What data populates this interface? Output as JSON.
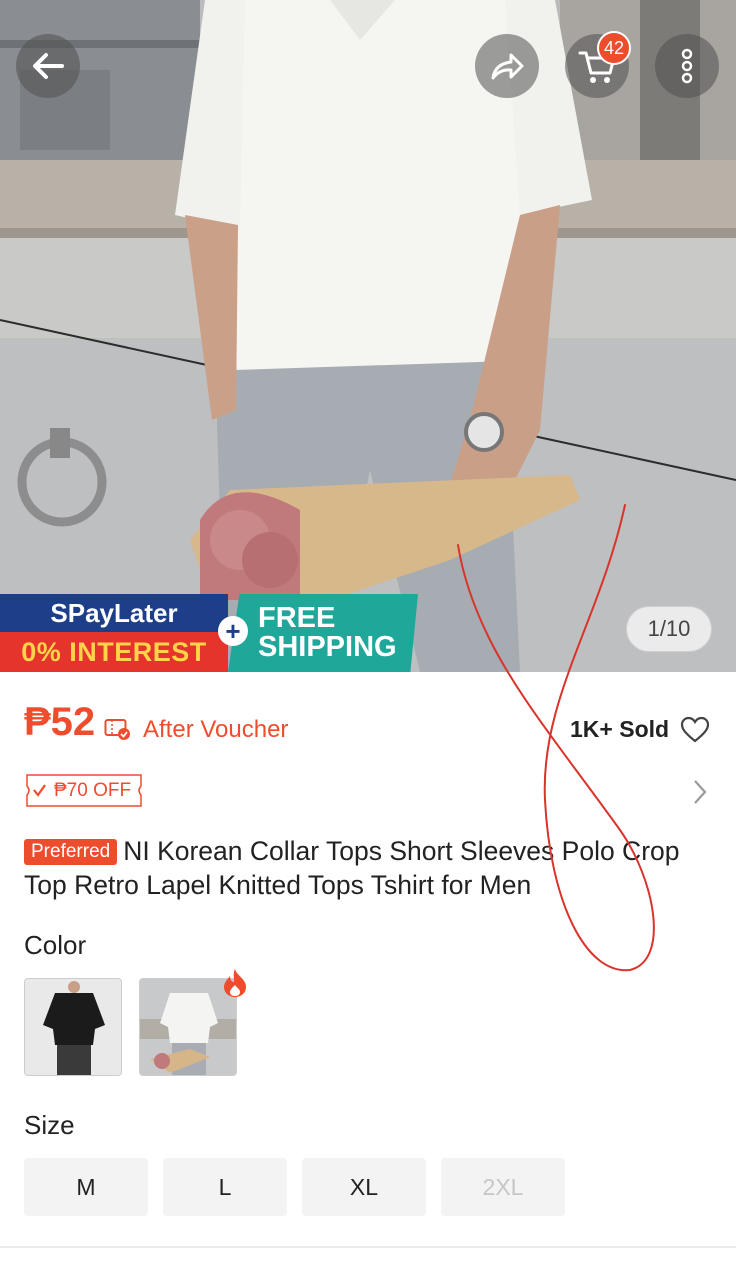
{
  "nav": {
    "back_icon": "arrow-left-icon",
    "share_icon": "share-icon",
    "cart_icon": "cart-icon",
    "cart_count": "42",
    "more_icon": "more-vertical-icon"
  },
  "gallery": {
    "counter": "1/10",
    "current_index": 1,
    "total": 10
  },
  "promo": {
    "spaylater": "SPayLater",
    "interest": "0% INTEREST",
    "free": "FREE",
    "shipping": "SHIPPING",
    "plus": "+"
  },
  "price": {
    "amount": "₱52",
    "after_voucher": "After Voucher",
    "sold": "1K+ Sold",
    "discount_tag": "₱70 OFF"
  },
  "product": {
    "badge": "Preferred",
    "title": "NI Korean Collar Tops Short Sleeves Polo Crop Top Retro Lapel Knitted Tops Tshirt for Men"
  },
  "color": {
    "label": "Color",
    "options": [
      "black-shirt-variant",
      "white-shirt-variant"
    ]
  },
  "size": {
    "label": "Size",
    "options": [
      "M",
      "L",
      "XL",
      "2XL"
    ],
    "disabled": [
      "2XL"
    ]
  },
  "colors": {
    "accent": "#ee4d2d",
    "spaylater_blue": "#1d3f8a",
    "shipping_teal": "#1fa89a",
    "interest_red": "#e5342b",
    "interest_yellow": "#ffd44a"
  }
}
